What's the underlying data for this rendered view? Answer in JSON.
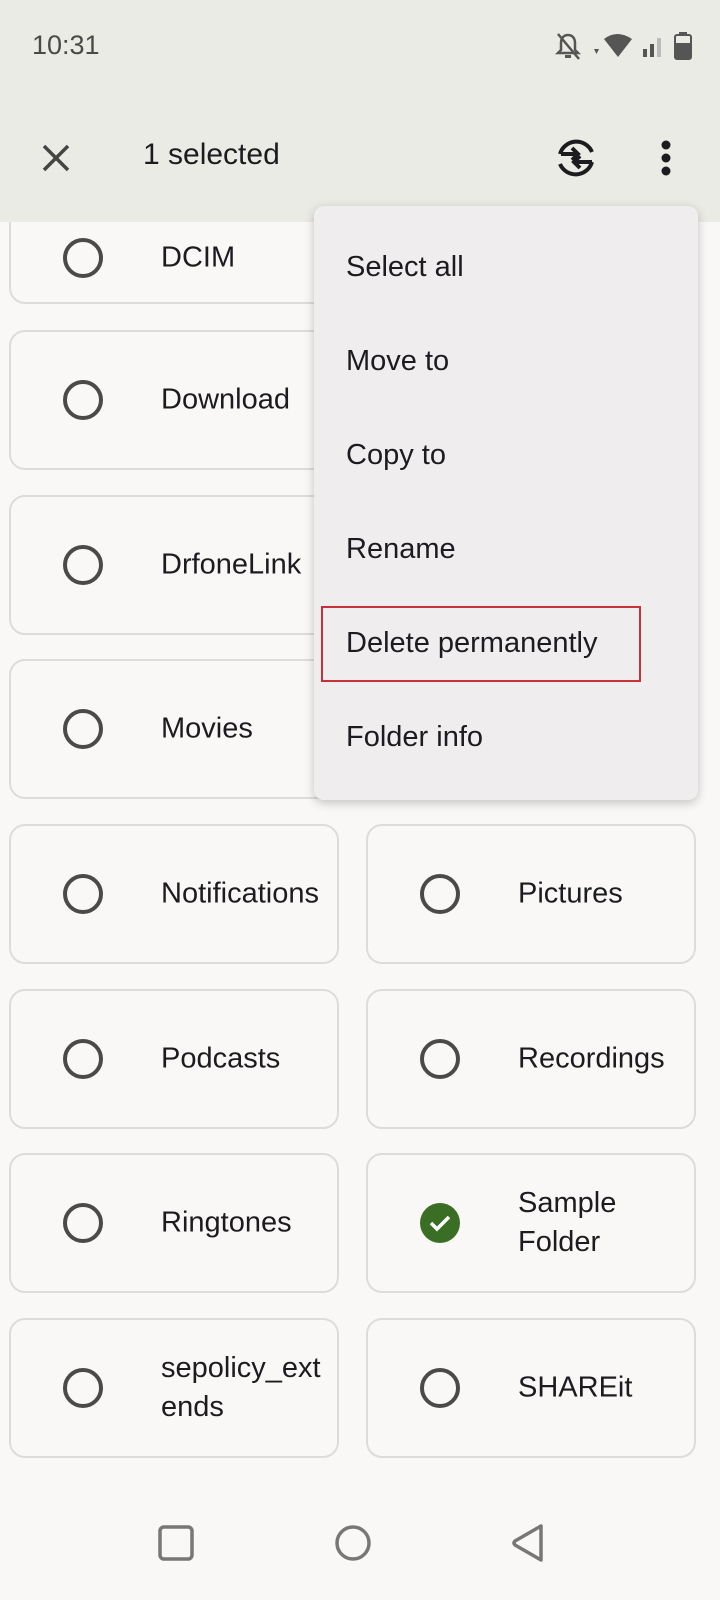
{
  "status_bar": {
    "time": "10:31",
    "icons": [
      "notifications-off-icon",
      "wifi-icon",
      "signal-icon",
      "battery-icon"
    ]
  },
  "app_bar": {
    "close_icon": "close-icon",
    "title": "1 selected",
    "sync_icon": "sync-arrows-icon",
    "more_icon": "more-vert-icon"
  },
  "folders": [
    {
      "name": "DCIM",
      "selected": false
    },
    {
      "name": "Download",
      "selected": false
    },
    {
      "name": "DrfoneLink",
      "selected": false
    },
    {
      "name": "Movies",
      "selected": false
    },
    {
      "name": "Notifications",
      "selected": false
    },
    {
      "name": "Pictures",
      "selected": false
    },
    {
      "name": "Podcasts",
      "selected": false
    },
    {
      "name": "Recordings",
      "selected": false
    },
    {
      "name": "Ringtones",
      "selected": false
    },
    {
      "name": "Sample Folder",
      "selected": true
    },
    {
      "name": "sepolicy_extends",
      "selected": false
    },
    {
      "name": "SHAREit",
      "selected": false
    }
  ],
  "menu": {
    "items": [
      {
        "label": "Select all"
      },
      {
        "label": "Move to"
      },
      {
        "label": "Copy to"
      },
      {
        "label": "Rename"
      },
      {
        "label": "Delete permanently",
        "highlighted": true
      },
      {
        "label": "Folder info"
      }
    ],
    "highlight_color": "#c8303a"
  },
  "colors": {
    "selected_check": "#3a6e24",
    "app_bar_bg": "#eaebe4"
  },
  "nav_bar": {
    "buttons": [
      "recents-icon",
      "home-icon",
      "back-icon"
    ]
  }
}
